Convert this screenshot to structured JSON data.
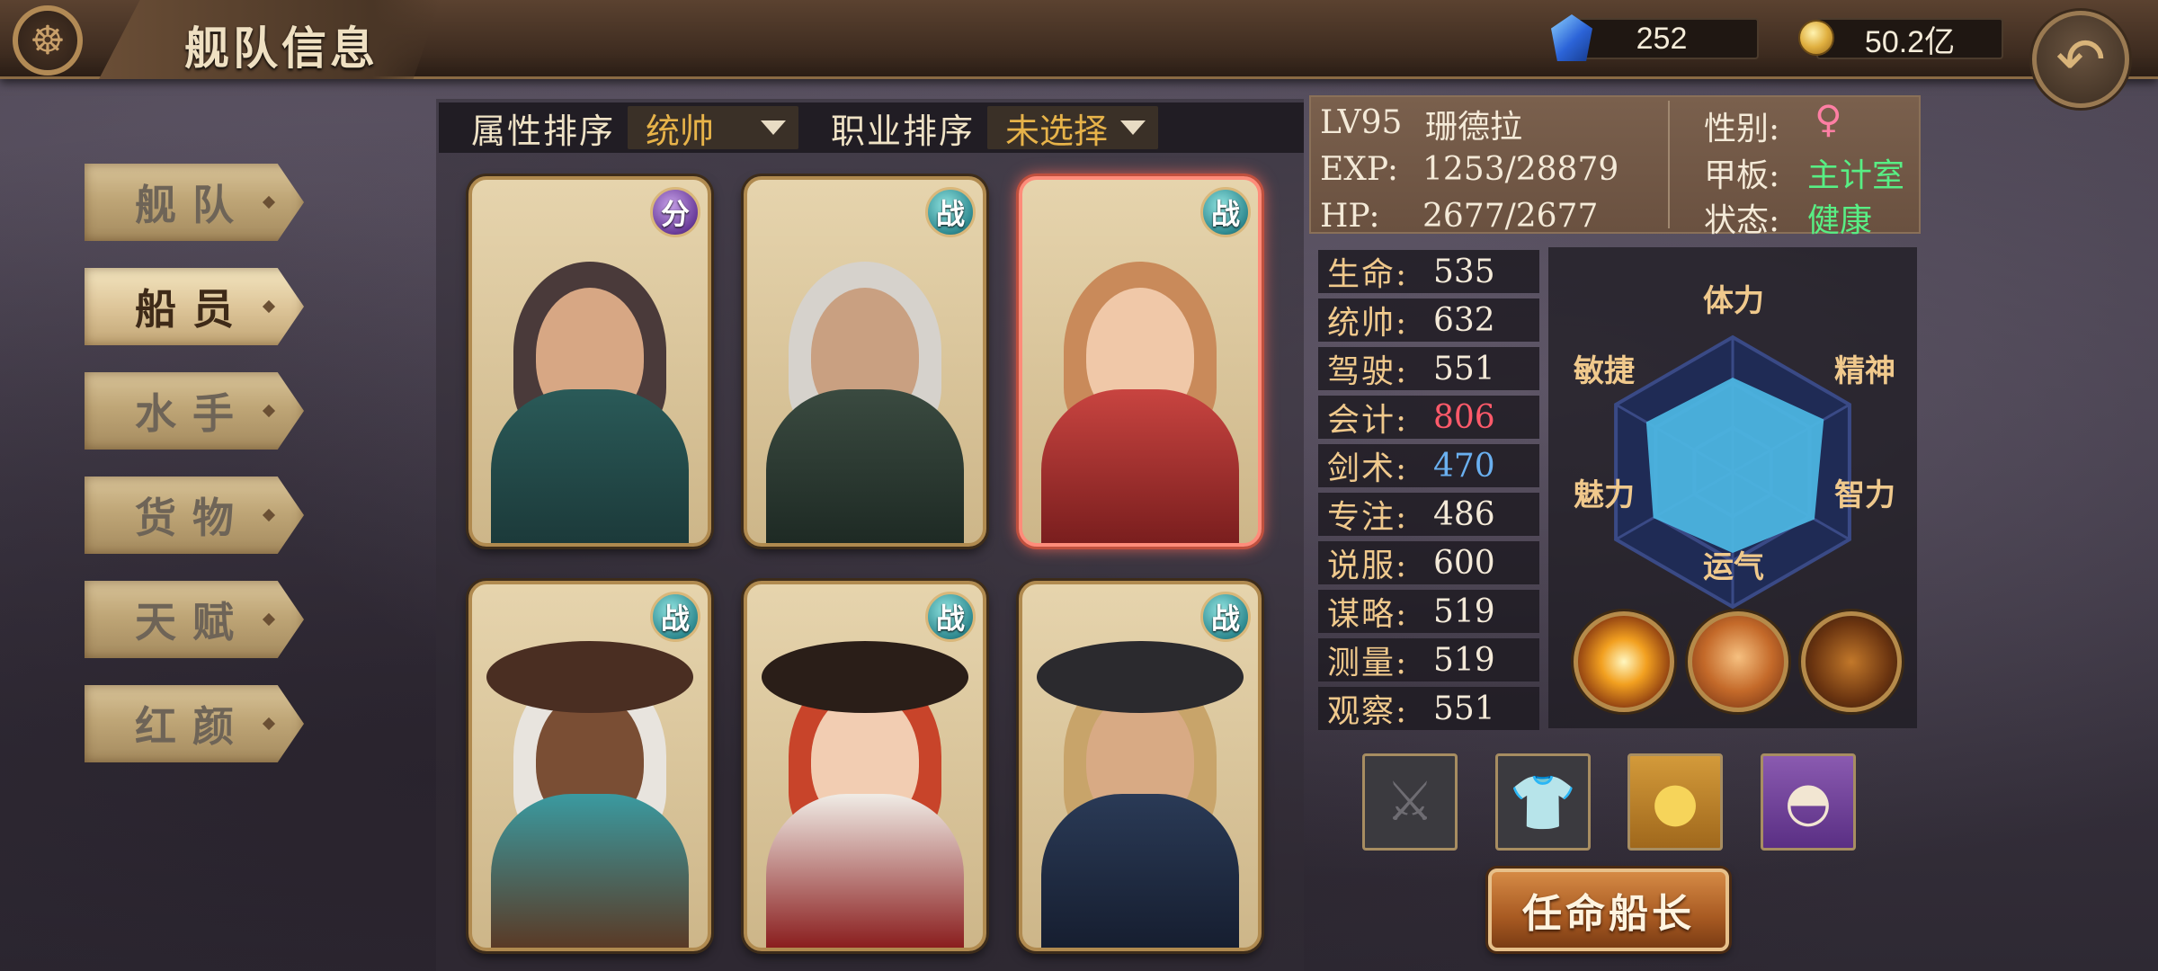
{
  "header": {
    "title": "舰队信息",
    "gems": "252",
    "gold": "50.2亿"
  },
  "sidebar": {
    "items": [
      {
        "label": "舰队",
        "active": false
      },
      {
        "label": "船员",
        "active": true
      },
      {
        "label": "水手",
        "active": false
      },
      {
        "label": "货物",
        "active": false
      },
      {
        "label": "天赋",
        "active": false
      },
      {
        "label": "红颜",
        "active": false
      }
    ]
  },
  "filters": {
    "attr_label": "属性排序",
    "attr_value": "统帅",
    "job_label": "职业排序",
    "job_value": "未选择"
  },
  "cards": [
    {
      "badge": "分",
      "selected": false
    },
    {
      "badge": "战",
      "selected": false
    },
    {
      "badge": "战",
      "selected": true
    },
    {
      "badge": "战",
      "selected": false
    },
    {
      "badge": "战",
      "selected": false
    },
    {
      "badge": "战",
      "selected": false
    }
  ],
  "info": {
    "level": "LV95",
    "name": "珊德拉",
    "exp_label": "EXP:",
    "exp": "1253/28879",
    "hp_label": "HP:",
    "hp": "2677/2677",
    "gender_label": "性别:",
    "gender": "♀",
    "deck_label": "甲板:",
    "deck": "主计室",
    "state_label": "状态:",
    "state": "健康"
  },
  "stats": [
    {
      "label": "生命:",
      "value": "535",
      "color": "#f4ead8"
    },
    {
      "label": "统帅:",
      "value": "632",
      "color": "#f4ead8"
    },
    {
      "label": "驾驶:",
      "value": "551",
      "color": "#f4ead8"
    },
    {
      "label": "会计:",
      "value": "806",
      "color": "#ff5a6a"
    },
    {
      "label": "剑术:",
      "value": "470",
      "color": "#6ab0f0"
    },
    {
      "label": "专注:",
      "value": "486",
      "color": "#f4ead8"
    },
    {
      "label": "说服:",
      "value": "600",
      "color": "#f4ead8"
    },
    {
      "label": "谋略:",
      "value": "519",
      "color": "#f4ead8"
    },
    {
      "label": "测量:",
      "value": "519",
      "color": "#f4ead8"
    },
    {
      "label": "观察:",
      "value": "551",
      "color": "#f4ead8"
    }
  ],
  "radar": {
    "labels": {
      "top": "体力",
      "top_right": "精神",
      "bottom_right": "智力",
      "bottom": "运气",
      "bottom_left": "魅力",
      "top_left": "敏捷"
    },
    "values": [
      0.7,
      0.78,
      0.7,
      0.6,
      0.68,
      0.74
    ],
    "fill_color": "#4cb4e0"
  },
  "skills": [
    "explosion-skill-icon",
    "scales-skill-icon",
    "shadow-figure-skill-icon"
  ],
  "equipment": [
    "sword-slot-icon",
    "armor-slot-icon",
    "gold-treasure-icon",
    "folding-fan-icon"
  ],
  "appoint_button": "任命船长"
}
